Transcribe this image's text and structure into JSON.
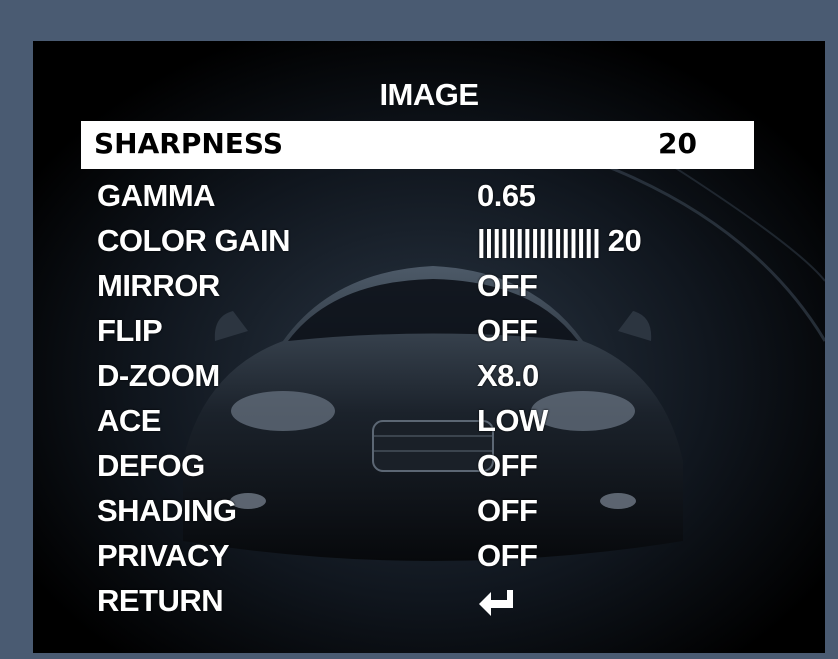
{
  "menu": {
    "title": "IMAGE",
    "items": [
      {
        "label": "SHARPNESS",
        "value": "20",
        "selected": true
      },
      {
        "label": "GAMMA",
        "value": "0.65"
      },
      {
        "label": "COLOR GAIN",
        "bars": "||||||||||||||||",
        "value": "20"
      },
      {
        "label": "MIRROR",
        "value": "OFF"
      },
      {
        "label": "FLIP",
        "value": "OFF"
      },
      {
        "label": "D-ZOOM",
        "value": "X8.0"
      },
      {
        "label": "ACE",
        "value": "LOW"
      },
      {
        "label": "DEFOG",
        "value": "OFF"
      },
      {
        "label": "SHADING",
        "value": "OFF"
      },
      {
        "label": "PRIVACY",
        "value": "OFF"
      },
      {
        "label": "RETURN",
        "icon": "return-arrow-icon"
      }
    ]
  },
  "colors": {
    "frame": "#4a5b72",
    "screen": "#000000",
    "text": "#ffffff",
    "highlight": "#ffffff",
    "highlight_text": "#000000"
  }
}
